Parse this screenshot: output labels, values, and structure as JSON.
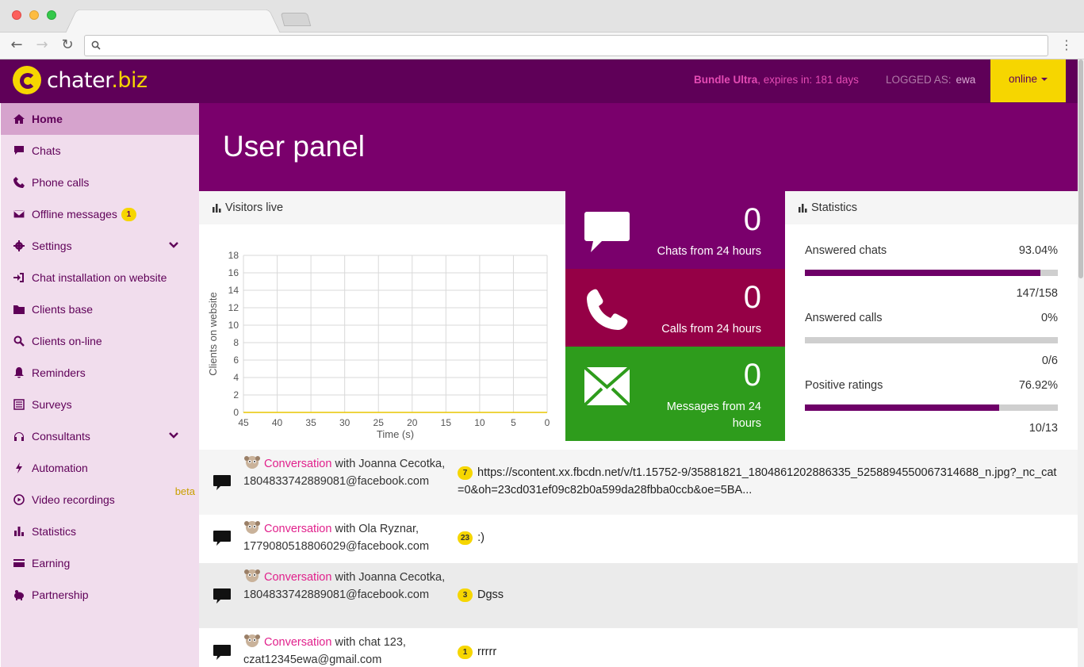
{
  "browser": {
    "back": "←",
    "forward": "→",
    "reload": "↻",
    "menu": "⋮",
    "url": ""
  },
  "header": {
    "logo_main": "chater",
    "logo_tld": ".biz",
    "bundle_name": "Bundle Ultra",
    "bundle_expiry": ", expires in: 181 days",
    "logged_label": "LOGGED AS:",
    "logged_user": "ewa",
    "status": "online"
  },
  "sidebar": {
    "items": [
      {
        "label": "Home",
        "icon": "home-icon"
      },
      {
        "label": "Chats",
        "icon": "chat-icon"
      },
      {
        "label": "Phone calls",
        "icon": "phone-icon"
      },
      {
        "label": "Offline messages",
        "icon": "envelope-icon",
        "badge": "1"
      },
      {
        "label": "Settings",
        "icon": "gear-icon"
      },
      {
        "label": "Chat installation on website",
        "icon": "sign-in-icon"
      },
      {
        "label": "Clients base",
        "icon": "folder-icon"
      },
      {
        "label": "Clients on-line",
        "icon": "search-icon"
      },
      {
        "label": "Reminders",
        "icon": "bell-icon"
      },
      {
        "label": "Surveys",
        "icon": "list-icon"
      },
      {
        "label": "Consultants",
        "icon": "headphones-icon"
      },
      {
        "label": "Automation",
        "icon": "bolt-icon"
      },
      {
        "label": "Video recordings",
        "icon": "play-circle-icon",
        "tag": "beta"
      },
      {
        "label": "Statistics",
        "icon": "bar-chart-icon"
      },
      {
        "label": "Earning",
        "icon": "credit-card-icon"
      },
      {
        "label": "Partnership",
        "icon": "piggy-bank-icon"
      }
    ]
  },
  "hero": {
    "title": "User panel"
  },
  "visitors": {
    "title": "Visitors live",
    "chart_data": {
      "type": "line",
      "title": "",
      "xlabel": "Time (s)",
      "ylabel": "Clients on website",
      "x": [
        45,
        40,
        35,
        30,
        25,
        20,
        15,
        10,
        5,
        0
      ],
      "x_ticks": [
        "45",
        "40",
        "35",
        "30",
        "25",
        "20",
        "15",
        "10",
        "5",
        "0"
      ],
      "y_ticks": [
        "0",
        "2",
        "4",
        "6",
        "8",
        "10",
        "12",
        "14",
        "16",
        "18"
      ],
      "series": [
        {
          "values": [
            0,
            0,
            0,
            0,
            0,
            0,
            0,
            0,
            0,
            0
          ]
        }
      ],
      "ylim": [
        0,
        18
      ],
      "xlim": [
        45,
        0
      ],
      "grid": true,
      "line_color": "#e8c600"
    }
  },
  "tiles": [
    {
      "num": "0",
      "label": "Chats from 24 hours",
      "color": "#7a006c"
    },
    {
      "num": "0",
      "label": "Calls from 24 hours",
      "color": "#950046"
    },
    {
      "num": "0",
      "label": "Messages from 24 hours",
      "color": "#2e9c1c"
    }
  ],
  "statistics": {
    "title": "Statistics",
    "rows": [
      {
        "label": "Answered chats",
        "pct": "93.04%",
        "fill": 0.9304,
        "ratio": "147/158"
      },
      {
        "label": "Answered calls",
        "pct": "0%",
        "fill": 0,
        "ratio": "0/6"
      },
      {
        "label": "Positive ratings",
        "pct": "76.92%",
        "fill": 0.7692,
        "ratio": "10/13"
      }
    ]
  },
  "conversations": [
    {
      "link": "Conversation",
      "rest": " with Joanna Cecotka, 1804833742889081@facebook.com",
      "count": "7",
      "msg": "https://scontent.xx.fbcdn.net/v/t1.15752-9/35881821_1804861202886335_5258894550067314688_n.jpg?_nc_cat=0&oh=23cd031ef09c82b0a599da28fbba0ccb&oe=5BA..."
    },
    {
      "link": "Conversation",
      "rest": " with Ola Ryznar, 1779080518806029@facebook.com",
      "count": "23",
      "msg": ":)"
    },
    {
      "link": "Conversation",
      "rest": " with Joanna Cecotka, 1804833742889081@facebook.com",
      "count": "3",
      "msg": "Dgss"
    },
    {
      "link": "Conversation",
      "rest": " with chat 123, czat12345ewa@gmail.com",
      "count": "1",
      "msg": "rrrrr"
    }
  ]
}
